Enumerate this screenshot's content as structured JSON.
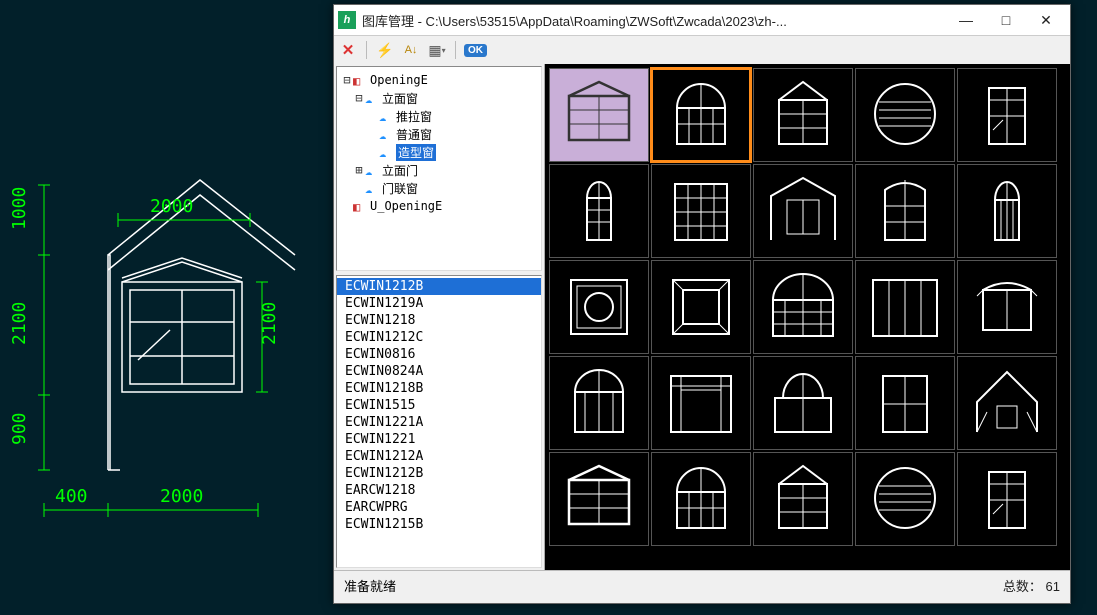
{
  "cad": {
    "dims": {
      "top_h": "2000",
      "left_top": "1000",
      "left_mid": "2100",
      "left_bot": "900",
      "right_mid": "2100",
      "bot_left": "400",
      "bot_right": "2000"
    }
  },
  "dialog": {
    "title": "图库管理 - C:\\Users\\53515\\AppData\\Roaming\\ZWSoft\\Zwcada\\2023\\zh-...",
    "toolbar": {
      "close": "✕",
      "flash": "⚡",
      "sort": "A↓",
      "grid": "▦",
      "ok": "OK"
    },
    "win_min": "—",
    "win_max": "□",
    "win_close": "✕"
  },
  "tree": {
    "root": "OpeningE",
    "n1": "立面窗",
    "n1a": "推拉窗",
    "n1b": "普通窗",
    "n1c": "造型窗",
    "n2": "立面门",
    "n3": "门联窗",
    "n4": "U_OpeningE"
  },
  "list": {
    "items": [
      "ECWIN1212B",
      "ECWIN1219A",
      "ECWIN1218",
      "ECWIN1212C",
      "ECWIN0816",
      "ECWIN0824A",
      "ECWIN1218B",
      "ECWIN1515",
      "ECWIN1221A",
      "ECWIN1221",
      "ECWIN1212A",
      "ECWIN1212B",
      "EARCW1218",
      "EARCWPRG",
      "ECWIN1215B"
    ],
    "selected": 0
  },
  "status": {
    "left": "准备就绪",
    "right_label": "总数：",
    "right_value": "61"
  },
  "thumbs": {
    "count": 25,
    "selected": 0,
    "highlighted": 1
  }
}
